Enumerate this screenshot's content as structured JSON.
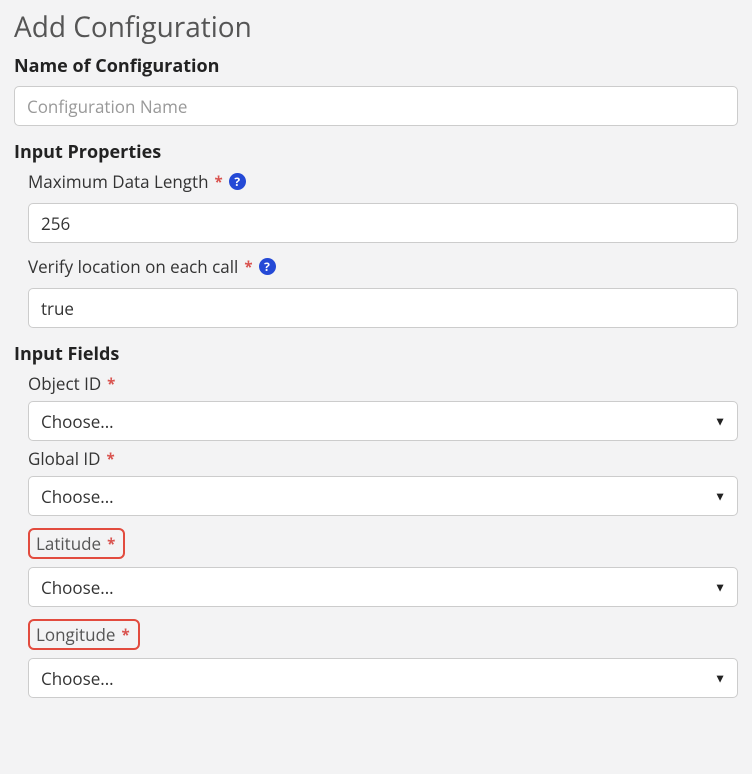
{
  "title": "Add Configuration",
  "nameSection": {
    "label": "Name of Configuration",
    "placeholder": "Configuration Name",
    "value": ""
  },
  "inputProperties": {
    "heading": "Input Properties",
    "maxDataLength": {
      "label": "Maximum Data Length",
      "value": "256",
      "required": "*",
      "help": "?"
    },
    "verifyLocation": {
      "label": "Verify location on each call",
      "value": "true",
      "required": "*",
      "help": "?"
    }
  },
  "inputFields": {
    "heading": "Input Fields",
    "objectId": {
      "label": "Object ID",
      "required": "*",
      "selected": "Choose..."
    },
    "globalId": {
      "label": "Global ID",
      "required": "*",
      "selected": "Choose..."
    },
    "latitude": {
      "label": "Latitude",
      "required": "*",
      "selected": "Choose..."
    },
    "longitude": {
      "label": "Longitude",
      "required": "*",
      "selected": "Choose..."
    }
  },
  "caret": "▼"
}
